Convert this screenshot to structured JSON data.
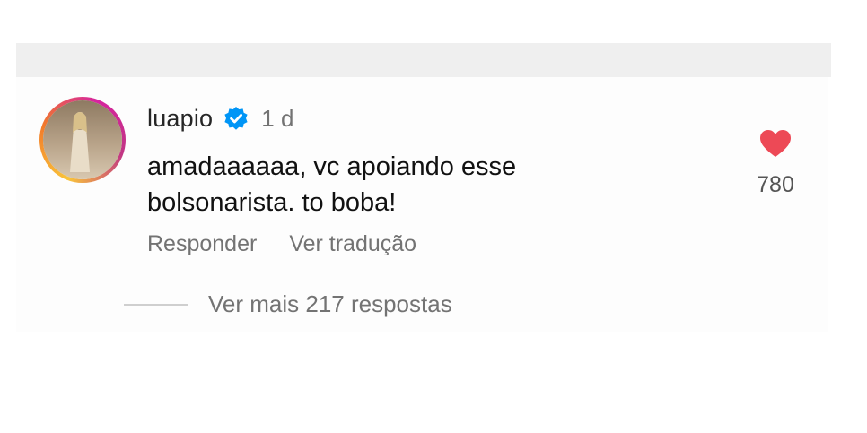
{
  "comment": {
    "username": "luapio",
    "verified_icon": "verified-badge-icon",
    "time": "1 d",
    "text_line1": "amadaaaaaa, vc apoiando esse",
    "text_line2": "bolsonarista. to boba!",
    "like_count": "780",
    "like_icon": "heart-icon",
    "like_color": "#ed4956",
    "actions": {
      "reply": "Responder",
      "translate": "Ver tradução"
    },
    "more_replies": "Ver mais 217 respostas"
  },
  "colors": {
    "verified": "#0095f6",
    "muted_text": "#737373",
    "primary_text": "#262626"
  }
}
